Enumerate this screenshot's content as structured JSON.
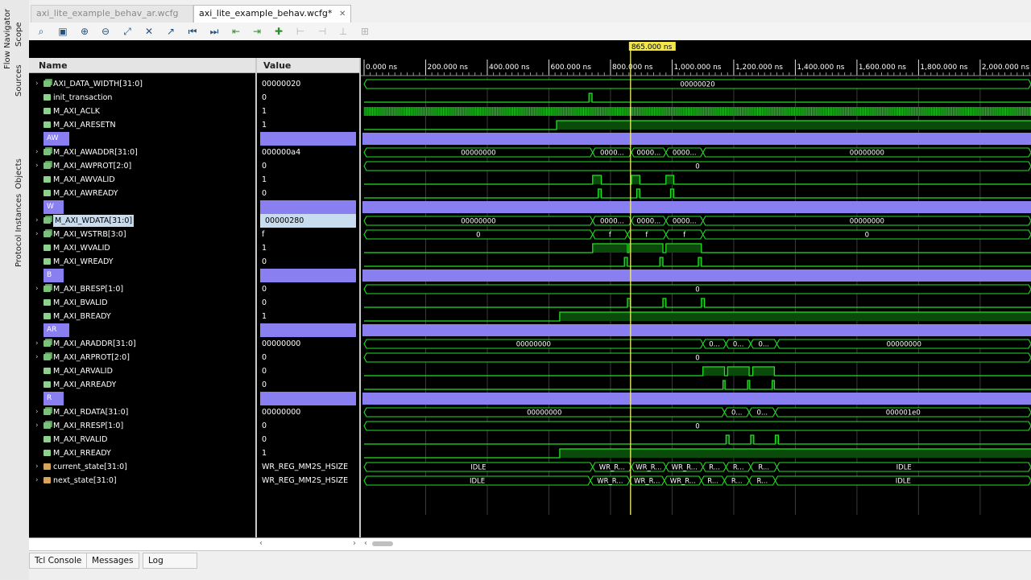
{
  "sidebar": {
    "tabs": [
      "Flow Navigator",
      "Scope",
      "Sources",
      "Objects",
      "Protocol Instances"
    ]
  },
  "tabs": [
    {
      "label": "axi_lite_example_behav_ar.wcfg",
      "active": false
    },
    {
      "label": "axi_lite_example_behav.wcfg*",
      "active": true
    }
  ],
  "toolbar": {
    "icons": [
      "search-icon",
      "save-icon",
      "zoom-in-icon",
      "zoom-out-icon",
      "zoom-fit-icon",
      "cursor-to-zero-icon",
      "go-to-cursor-icon",
      "go-to-start-icon",
      "go-to-end-icon",
      "previous-transition-icon",
      "next-transition-icon",
      "add-marker-icon",
      "previous-marker-icon",
      "next-marker-icon",
      "swap-cursors-icon",
      "snap-icon"
    ]
  },
  "columns": {
    "name": "Name",
    "value": "Value"
  },
  "cursor": {
    "label": "865.000 ns",
    "time_ns": 865
  },
  "timeline": {
    "ticks": [
      "0.000 ns",
      "200.000 ns",
      "400.000 ns",
      "600.000 ns",
      "800.000 ns",
      "1,000.000 ns",
      "1,200.000 ns",
      "1,400.000 ns",
      "1,600.000 ns",
      "1,800.000 ns",
      "2,000.000 ns"
    ],
    "range_ns": [
      0,
      2165
    ]
  },
  "signals": [
    {
      "name": "AXI_DATA_WIDTH[31:0]",
      "value": "00000020",
      "kind": "bus",
      "expand": true,
      "wave": {
        "type": "bus",
        "segments": [
          [
            0,
            2165,
            "00000020"
          ]
        ]
      }
    },
    {
      "name": "init_transaction",
      "value": "0",
      "kind": "bit",
      "wave": {
        "type": "bit",
        "init": 0,
        "edges": [
          [
            730,
            1
          ],
          [
            740,
            0
          ]
        ]
      }
    },
    {
      "name": "M_AXI_ACLK",
      "value": "1",
      "kind": "bit",
      "wave": {
        "type": "clock",
        "period": 10
      }
    },
    {
      "name": "M_AXI_ARESETN",
      "value": "1",
      "kind": "bit",
      "wave": {
        "type": "bit",
        "init": 0,
        "edges": [
          [
            625,
            1
          ]
        ]
      }
    },
    {
      "name": "AW",
      "kind": "group"
    },
    {
      "name": "M_AXI_AWADDR[31:0]",
      "value": "000000a4",
      "kind": "bus",
      "expand": true,
      "wave": {
        "type": "bus",
        "segments": [
          [
            0,
            742,
            "00000000"
          ],
          [
            742,
            868,
            "0000..."
          ],
          [
            868,
            980,
            "0000..."
          ],
          [
            980,
            1100,
            "0000..."
          ],
          [
            1100,
            2165,
            "00000000"
          ]
        ]
      }
    },
    {
      "name": "M_AXI_AWPROT[2:0]",
      "value": "0",
      "kind": "bus",
      "expand": true,
      "wave": {
        "type": "bus",
        "segments": [
          [
            0,
            2165,
            "0"
          ]
        ]
      }
    },
    {
      "name": "M_AXI_AWVALID",
      "value": "1",
      "kind": "bit",
      "wave": {
        "type": "bit",
        "init": 0,
        "edges": [
          [
            742,
            1
          ],
          [
            770,
            0
          ],
          [
            868,
            1
          ],
          [
            895,
            0
          ],
          [
            980,
            1
          ],
          [
            1005,
            0
          ]
        ]
      }
    },
    {
      "name": "M_AXI_AWREADY",
      "value": "0",
      "kind": "bit",
      "wave": {
        "type": "bit",
        "init": 0,
        "edges": [
          [
            760,
            1
          ],
          [
            770,
            0
          ],
          [
            885,
            1
          ],
          [
            895,
            0
          ],
          [
            995,
            1
          ],
          [
            1005,
            0
          ]
        ]
      }
    },
    {
      "name": "W",
      "kind": "group"
    },
    {
      "name": "M_AXI_WDATA[31:0]",
      "value": "00000280",
      "kind": "bus",
      "expand": true,
      "selected": true,
      "wave": {
        "type": "bus",
        "segments": [
          [
            0,
            742,
            "00000000"
          ],
          [
            742,
            868,
            "0000..."
          ],
          [
            868,
            980,
            "0000..."
          ],
          [
            980,
            1100,
            "0000..."
          ],
          [
            1100,
            2165,
            "00000000"
          ]
        ]
      }
    },
    {
      "name": "M_AXI_WSTRB[3:0]",
      "value": "f",
      "kind": "bus",
      "expand": true,
      "wave": {
        "type": "bus",
        "segments": [
          [
            0,
            742,
            "0"
          ],
          [
            742,
            855,
            "f"
          ],
          [
            855,
            980,
            "f"
          ],
          [
            980,
            1100,
            "f"
          ],
          [
            1100,
            2165,
            "0"
          ]
        ]
      }
    },
    {
      "name": "M_AXI_WVALID",
      "value": "1",
      "kind": "bit",
      "wave": {
        "type": "bit",
        "init": 0,
        "edges": [
          [
            742,
            1
          ],
          [
            855,
            0
          ],
          [
            860,
            1
          ],
          [
            970,
            0
          ],
          [
            980,
            1
          ],
          [
            1095,
            0
          ]
        ]
      }
    },
    {
      "name": "M_AXI_WREADY",
      "value": "0",
      "kind": "bit",
      "wave": {
        "type": "bit",
        "init": 0,
        "edges": [
          [
            845,
            1
          ],
          [
            855,
            0
          ],
          [
            960,
            1
          ],
          [
            970,
            0
          ],
          [
            1085,
            1
          ],
          [
            1095,
            0
          ]
        ]
      }
    },
    {
      "name": "B",
      "kind": "group"
    },
    {
      "name": "M_AXI_BRESP[1:0]",
      "value": "0",
      "kind": "bus",
      "expand": true,
      "wave": {
        "type": "bus",
        "segments": [
          [
            0,
            2165,
            "0"
          ]
        ]
      }
    },
    {
      "name": "M_AXI_BVALID",
      "value": "0",
      "kind": "bit",
      "wave": {
        "type": "bit",
        "init": 0,
        "edges": [
          [
            855,
            1
          ],
          [
            865,
            0
          ],
          [
            970,
            1
          ],
          [
            980,
            0
          ],
          [
            1095,
            1
          ],
          [
            1105,
            0
          ]
        ]
      }
    },
    {
      "name": "M_AXI_BREADY",
      "value": "1",
      "kind": "bit",
      "wave": {
        "type": "bit",
        "init": 0,
        "edges": [
          [
            635,
            1
          ]
        ]
      }
    },
    {
      "name": "AR",
      "kind": "group"
    },
    {
      "name": "M_AXI_ARADDR[31:0]",
      "value": "00000000",
      "kind": "bus",
      "expand": true,
      "wave": {
        "type": "bus",
        "segments": [
          [
            0,
            1100,
            "00000000"
          ],
          [
            1100,
            1175,
            "0..."
          ],
          [
            1175,
            1255,
            "0..."
          ],
          [
            1255,
            1340,
            "0..."
          ],
          [
            1340,
            2165,
            "00000000"
          ]
        ]
      }
    },
    {
      "name": "M_AXI_ARPROT[2:0]",
      "value": "0",
      "kind": "bus",
      "expand": true,
      "wave": {
        "type": "bus",
        "segments": [
          [
            0,
            2165,
            "0"
          ]
        ]
      }
    },
    {
      "name": "M_AXI_ARVALID",
      "value": "0",
      "kind": "bit",
      "wave": {
        "type": "bit",
        "init": 0,
        "edges": [
          [
            1100,
            1
          ],
          [
            1170,
            0
          ],
          [
            1180,
            1
          ],
          [
            1250,
            0
          ],
          [
            1262,
            1
          ],
          [
            1332,
            0
          ]
        ]
      }
    },
    {
      "name": "M_AXI_ARREADY",
      "value": "0",
      "kind": "bit",
      "wave": {
        "type": "bit",
        "init": 0,
        "edges": [
          [
            1165,
            1
          ],
          [
            1172,
            0
          ],
          [
            1245,
            1
          ],
          [
            1252,
            0
          ],
          [
            1325,
            1
          ],
          [
            1332,
            0
          ]
        ]
      }
    },
    {
      "name": "R",
      "kind": "group"
    },
    {
      "name": "M_AXI_RDATA[31:0]",
      "value": "00000000",
      "kind": "bus",
      "expand": true,
      "wave": {
        "type": "bus",
        "segments": [
          [
            0,
            1170,
            "00000000"
          ],
          [
            1170,
            1250,
            "0..."
          ],
          [
            1250,
            1335,
            "0..."
          ],
          [
            1335,
            2165,
            "000001e0"
          ]
        ]
      }
    },
    {
      "name": "M_AXI_RRESP[1:0]",
      "value": "0",
      "kind": "bus",
      "expand": true,
      "wave": {
        "type": "bus",
        "segments": [
          [
            0,
            2165,
            "0"
          ]
        ]
      }
    },
    {
      "name": "M_AXI_RVALID",
      "value": "0",
      "kind": "bit",
      "wave": {
        "type": "bit",
        "init": 0,
        "edges": [
          [
            1175,
            1
          ],
          [
            1185,
            0
          ],
          [
            1255,
            1
          ],
          [
            1265,
            0
          ],
          [
            1335,
            1
          ],
          [
            1345,
            0
          ]
        ]
      }
    },
    {
      "name": "M_AXI_RREADY",
      "value": "1",
      "kind": "bit",
      "wave": {
        "type": "bit",
        "init": 0,
        "edges": [
          [
            635,
            1
          ]
        ]
      }
    },
    {
      "name": "current_state[31:0]",
      "value": "WR_REG_MM2S_HSIZE",
      "kind": "state",
      "expand": true,
      "wave": {
        "type": "bus",
        "segments": [
          [
            0,
            742,
            "IDLE"
          ],
          [
            742,
            868,
            "WR_R..."
          ],
          [
            868,
            980,
            "WR_R..."
          ],
          [
            980,
            1100,
            "WR_R..."
          ],
          [
            1100,
            1175,
            "R..."
          ],
          [
            1175,
            1255,
            "R..."
          ],
          [
            1255,
            1340,
            "R..."
          ],
          [
            1340,
            2165,
            "IDLE"
          ]
        ]
      }
    },
    {
      "name": "next_state[31:0]",
      "value": "WR_REG_MM2S_HSIZE",
      "kind": "state",
      "expand": true,
      "wave": {
        "type": "bus",
        "segments": [
          [
            0,
            735,
            "IDLE"
          ],
          [
            735,
            862,
            "WR_R..."
          ],
          [
            862,
            975,
            "WR_R..."
          ],
          [
            975,
            1095,
            "WR_R..."
          ],
          [
            1095,
            1170,
            "R..."
          ],
          [
            1170,
            1250,
            "R..."
          ],
          [
            1250,
            1335,
            "R..."
          ],
          [
            1335,
            2165,
            "IDLE"
          ]
        ]
      }
    }
  ],
  "bottom_tabs": [
    "Tcl Console",
    "Messages",
    "Log"
  ],
  "colors": {
    "wave": "#22e022",
    "bus_fill": "#0a4a0a",
    "group": "#8a7ff0",
    "cursor": "#f0f070",
    "cursor_label_bg": "#f2e64a",
    "clock": "#22c822"
  }
}
